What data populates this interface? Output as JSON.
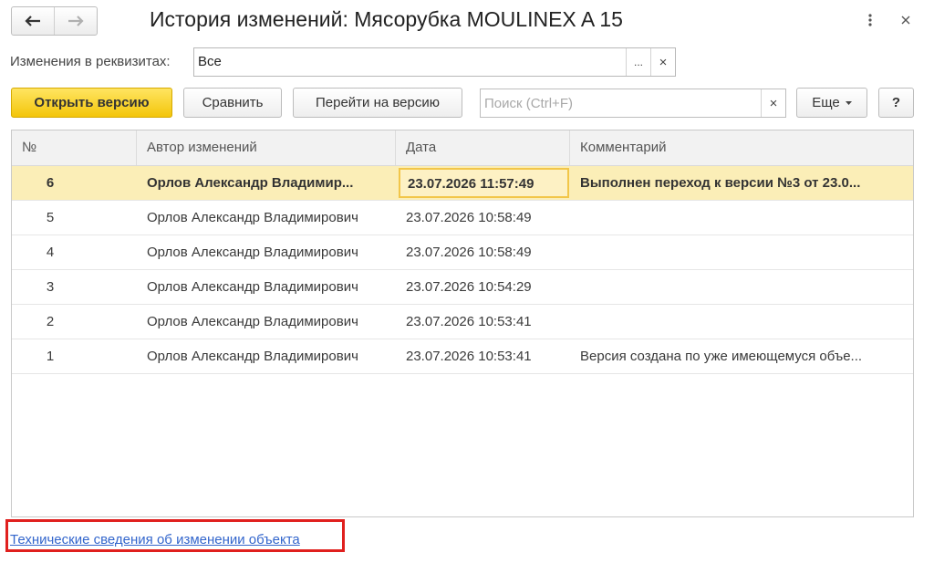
{
  "window": {
    "title": "История изменений: Мясорубка MOULINEX  A 15"
  },
  "filter": {
    "label": "Изменения в реквизитах:",
    "value": "Все",
    "select_glyph": "...",
    "clear_glyph": "×"
  },
  "toolbar": {
    "open_version": "Открыть версию",
    "compare": "Сравнить",
    "goto_version": "Перейти на версию",
    "search_placeholder": "Поиск (Ctrl+F)",
    "search_clear": "×",
    "more": "Еще",
    "help": "?"
  },
  "table": {
    "columns": [
      "№",
      "Автор изменений",
      "Дата",
      "Комментарий"
    ],
    "rows": [
      {
        "num": "6",
        "author": "Орлов Александр Владимир...",
        "date": "23.07.2026 11:57:49",
        "comment": "Выполнен переход к версии №3 от 23.0...",
        "selected": true
      },
      {
        "num": "5",
        "author": "Орлов Александр Владимирович",
        "date": "23.07.2026 10:58:49",
        "comment": ""
      },
      {
        "num": "4",
        "author": "Орлов Александр Владимирович",
        "date": "23.07.2026 10:58:49",
        "comment": ""
      },
      {
        "num": "3",
        "author": "Орлов Александр Владимирович",
        "date": "23.07.2026 10:54:29",
        "comment": ""
      },
      {
        "num": "2",
        "author": "Орлов Александр Владимирович",
        "date": "23.07.2026 10:53:41",
        "comment": ""
      },
      {
        "num": "1",
        "author": "Орлов Александр Владимирович",
        "date": "23.07.2026 10:53:41",
        "comment": "Версия создана по уже имеющемуся объе..."
      }
    ]
  },
  "footer": {
    "tech_link": "Технические сведения об изменении объекта"
  },
  "colors": {
    "primary_button": "#f3c50a",
    "selected_row": "#fbeeb7",
    "link": "#3366cc",
    "highlight_box": "#e0201e"
  }
}
